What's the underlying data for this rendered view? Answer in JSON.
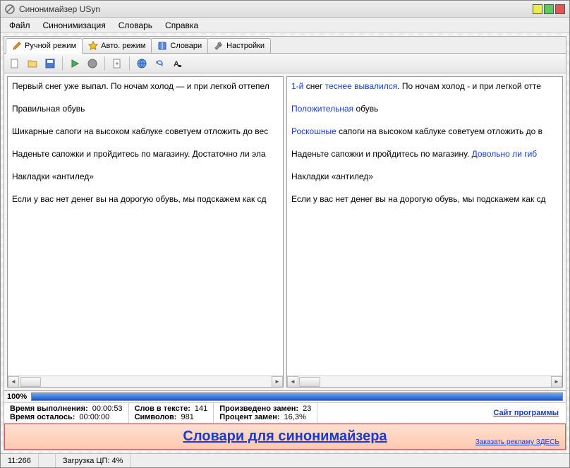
{
  "window": {
    "title": "Синонимайзер USyn"
  },
  "menu": {
    "items": [
      "Файл",
      "Синонимизация",
      "Словарь",
      "Справка"
    ]
  },
  "tabs": [
    {
      "label": "Ручной режим",
      "icon": "pencil",
      "active": true
    },
    {
      "label": "Авто. режим",
      "icon": "star",
      "active": false
    },
    {
      "label": "Словари",
      "icon": "book",
      "active": false
    },
    {
      "label": "Настройки",
      "icon": "wrench",
      "active": false
    }
  ],
  "toolbar": {
    "buttons": [
      "new",
      "open",
      "save",
      "sep",
      "run",
      "stop",
      "sep",
      "export",
      "sep",
      "globe",
      "refresh",
      "font"
    ]
  },
  "left_pane": {
    "lines": [
      [
        {
          "t": "Первый снег уже выпал. По ночам холод — и при легкой оттепел"
        }
      ],
      [
        {
          "t": "Правильная обувь"
        }
      ],
      [
        {
          "t": "Шикарные сапоги на высоком каблуке советуем отложить до вес"
        }
      ],
      [
        {
          "t": "Наденьте сапожки и пройдитесь по магазину. Достаточно ли эла"
        }
      ],
      [
        {
          "t": "Накладки «антилед»"
        }
      ],
      [
        {
          "t": "Если у вас нет денег вы на дорогую обувь, мы подскажем как сд"
        }
      ]
    ]
  },
  "right_pane": {
    "lines": [
      [
        {
          "t": "1-й",
          "s": true
        },
        {
          "t": " снег "
        },
        {
          "t": "теснее",
          "s": true
        },
        {
          "t": " "
        },
        {
          "t": "вывалился",
          "s": true
        },
        {
          "t": ". По ночам холод - и при легкой отте"
        }
      ],
      [
        {
          "t": "Положительная",
          "s": true
        },
        {
          "t": " обувь"
        }
      ],
      [
        {
          "t": "Роскошные",
          "s": true
        },
        {
          "t": " сапоги на высоком каблуке советуем отложить до в"
        }
      ],
      [
        {
          "t": "Наденьте сапожки и пройдитесь по магазину. "
        },
        {
          "t": "Довольно ли",
          "s": true
        },
        {
          "t": " "
        },
        {
          "t": "гиб",
          "s": true
        }
      ],
      [
        {
          "t": "Накладки «антилед»"
        }
      ],
      [
        {
          "t": "Если у вас нет денег вы на дорогую обувь, мы подскажем как сд"
        }
      ]
    ]
  },
  "progress": {
    "label": "100%"
  },
  "stats": {
    "col1": [
      {
        "key": "Время выполнения:",
        "val": "00:00:53"
      },
      {
        "key": "Время осталось:",
        "val": "00:00:00"
      }
    ],
    "col2": [
      {
        "key": "Слов в тексте:",
        "val": "141"
      },
      {
        "key": "Символов:",
        "val": "981"
      }
    ],
    "col3": [
      {
        "key": "Произведено замен:",
        "val": "23"
      },
      {
        "key": "Процент замен:",
        "val": "16,3%"
      }
    ],
    "link": "Сайт программы"
  },
  "ad": {
    "main": "Словари для синонимайзера",
    "small": "Заказать рекламу ЗДЕСЬ"
  },
  "status": {
    "pos": "11:266",
    "cpu": "Загрузка ЦП: 4%"
  }
}
